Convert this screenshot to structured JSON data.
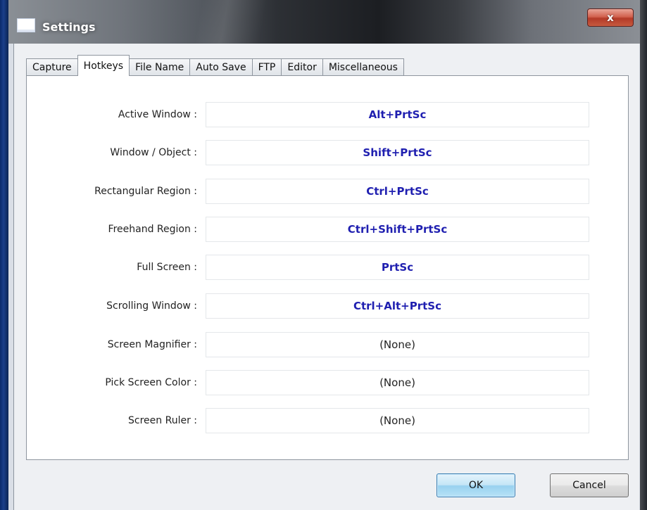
{
  "window": {
    "title": "Settings",
    "close_glyph": "x",
    "icon": "window-app-icon"
  },
  "tabs": [
    {
      "label": "Capture",
      "active": false
    },
    {
      "label": "Hotkeys",
      "active": true
    },
    {
      "label": "File Name",
      "active": false
    },
    {
      "label": "Auto Save",
      "active": false
    },
    {
      "label": "FTP",
      "active": false
    },
    {
      "label": "Editor",
      "active": false
    },
    {
      "label": "Miscellaneous",
      "active": false
    }
  ],
  "hotkeys": [
    {
      "label": "Active Window :",
      "value": "Alt+PrtSc"
    },
    {
      "label": "Window / Object :",
      "value": "Shift+PrtSc"
    },
    {
      "label": "Rectangular Region :",
      "value": "Ctrl+PrtSc"
    },
    {
      "label": "Freehand Region :",
      "value": "Ctrl+Shift+PrtSc"
    },
    {
      "label": "Full Screen :",
      "value": "PrtSc"
    },
    {
      "label": "Scrolling Window :",
      "value": "Ctrl+Alt+PrtSc"
    },
    {
      "label": "Screen Magnifier :",
      "value": "(None)"
    },
    {
      "label": "Pick Screen Color :",
      "value": "(None)"
    },
    {
      "label": "Screen Ruler :",
      "value": "(None)"
    }
  ],
  "buttons": {
    "ok": "OK",
    "cancel": "Cancel"
  },
  "colors": {
    "assigned_hotkey": "#1f1fb0",
    "unassigned_hotkey": "#222222"
  }
}
